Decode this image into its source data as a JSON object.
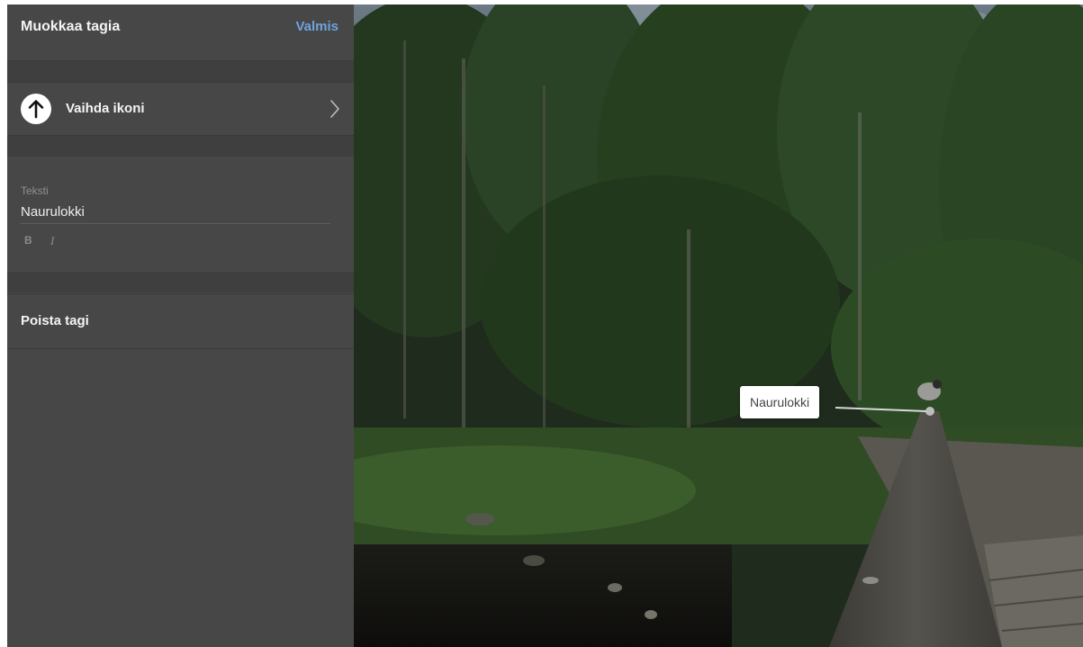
{
  "panel": {
    "title": "Muokkaa tagia",
    "done_label": "Valmis",
    "change_icon_label": "Vaihda ikoni",
    "text_section": {
      "label": "Teksti",
      "value": "Naurulokki",
      "bold_label": "B",
      "italic_label": "I"
    },
    "delete_label": "Poista tagi"
  },
  "scene": {
    "tag_label": "Naurulokki"
  },
  "colors": {
    "panel_bg": "#474747",
    "accent": "#6fa3de",
    "text": "#f4f4f4"
  },
  "icons": {
    "current_tag_icon": "arrow-up-icon",
    "chevron": "chevron-right-icon"
  }
}
